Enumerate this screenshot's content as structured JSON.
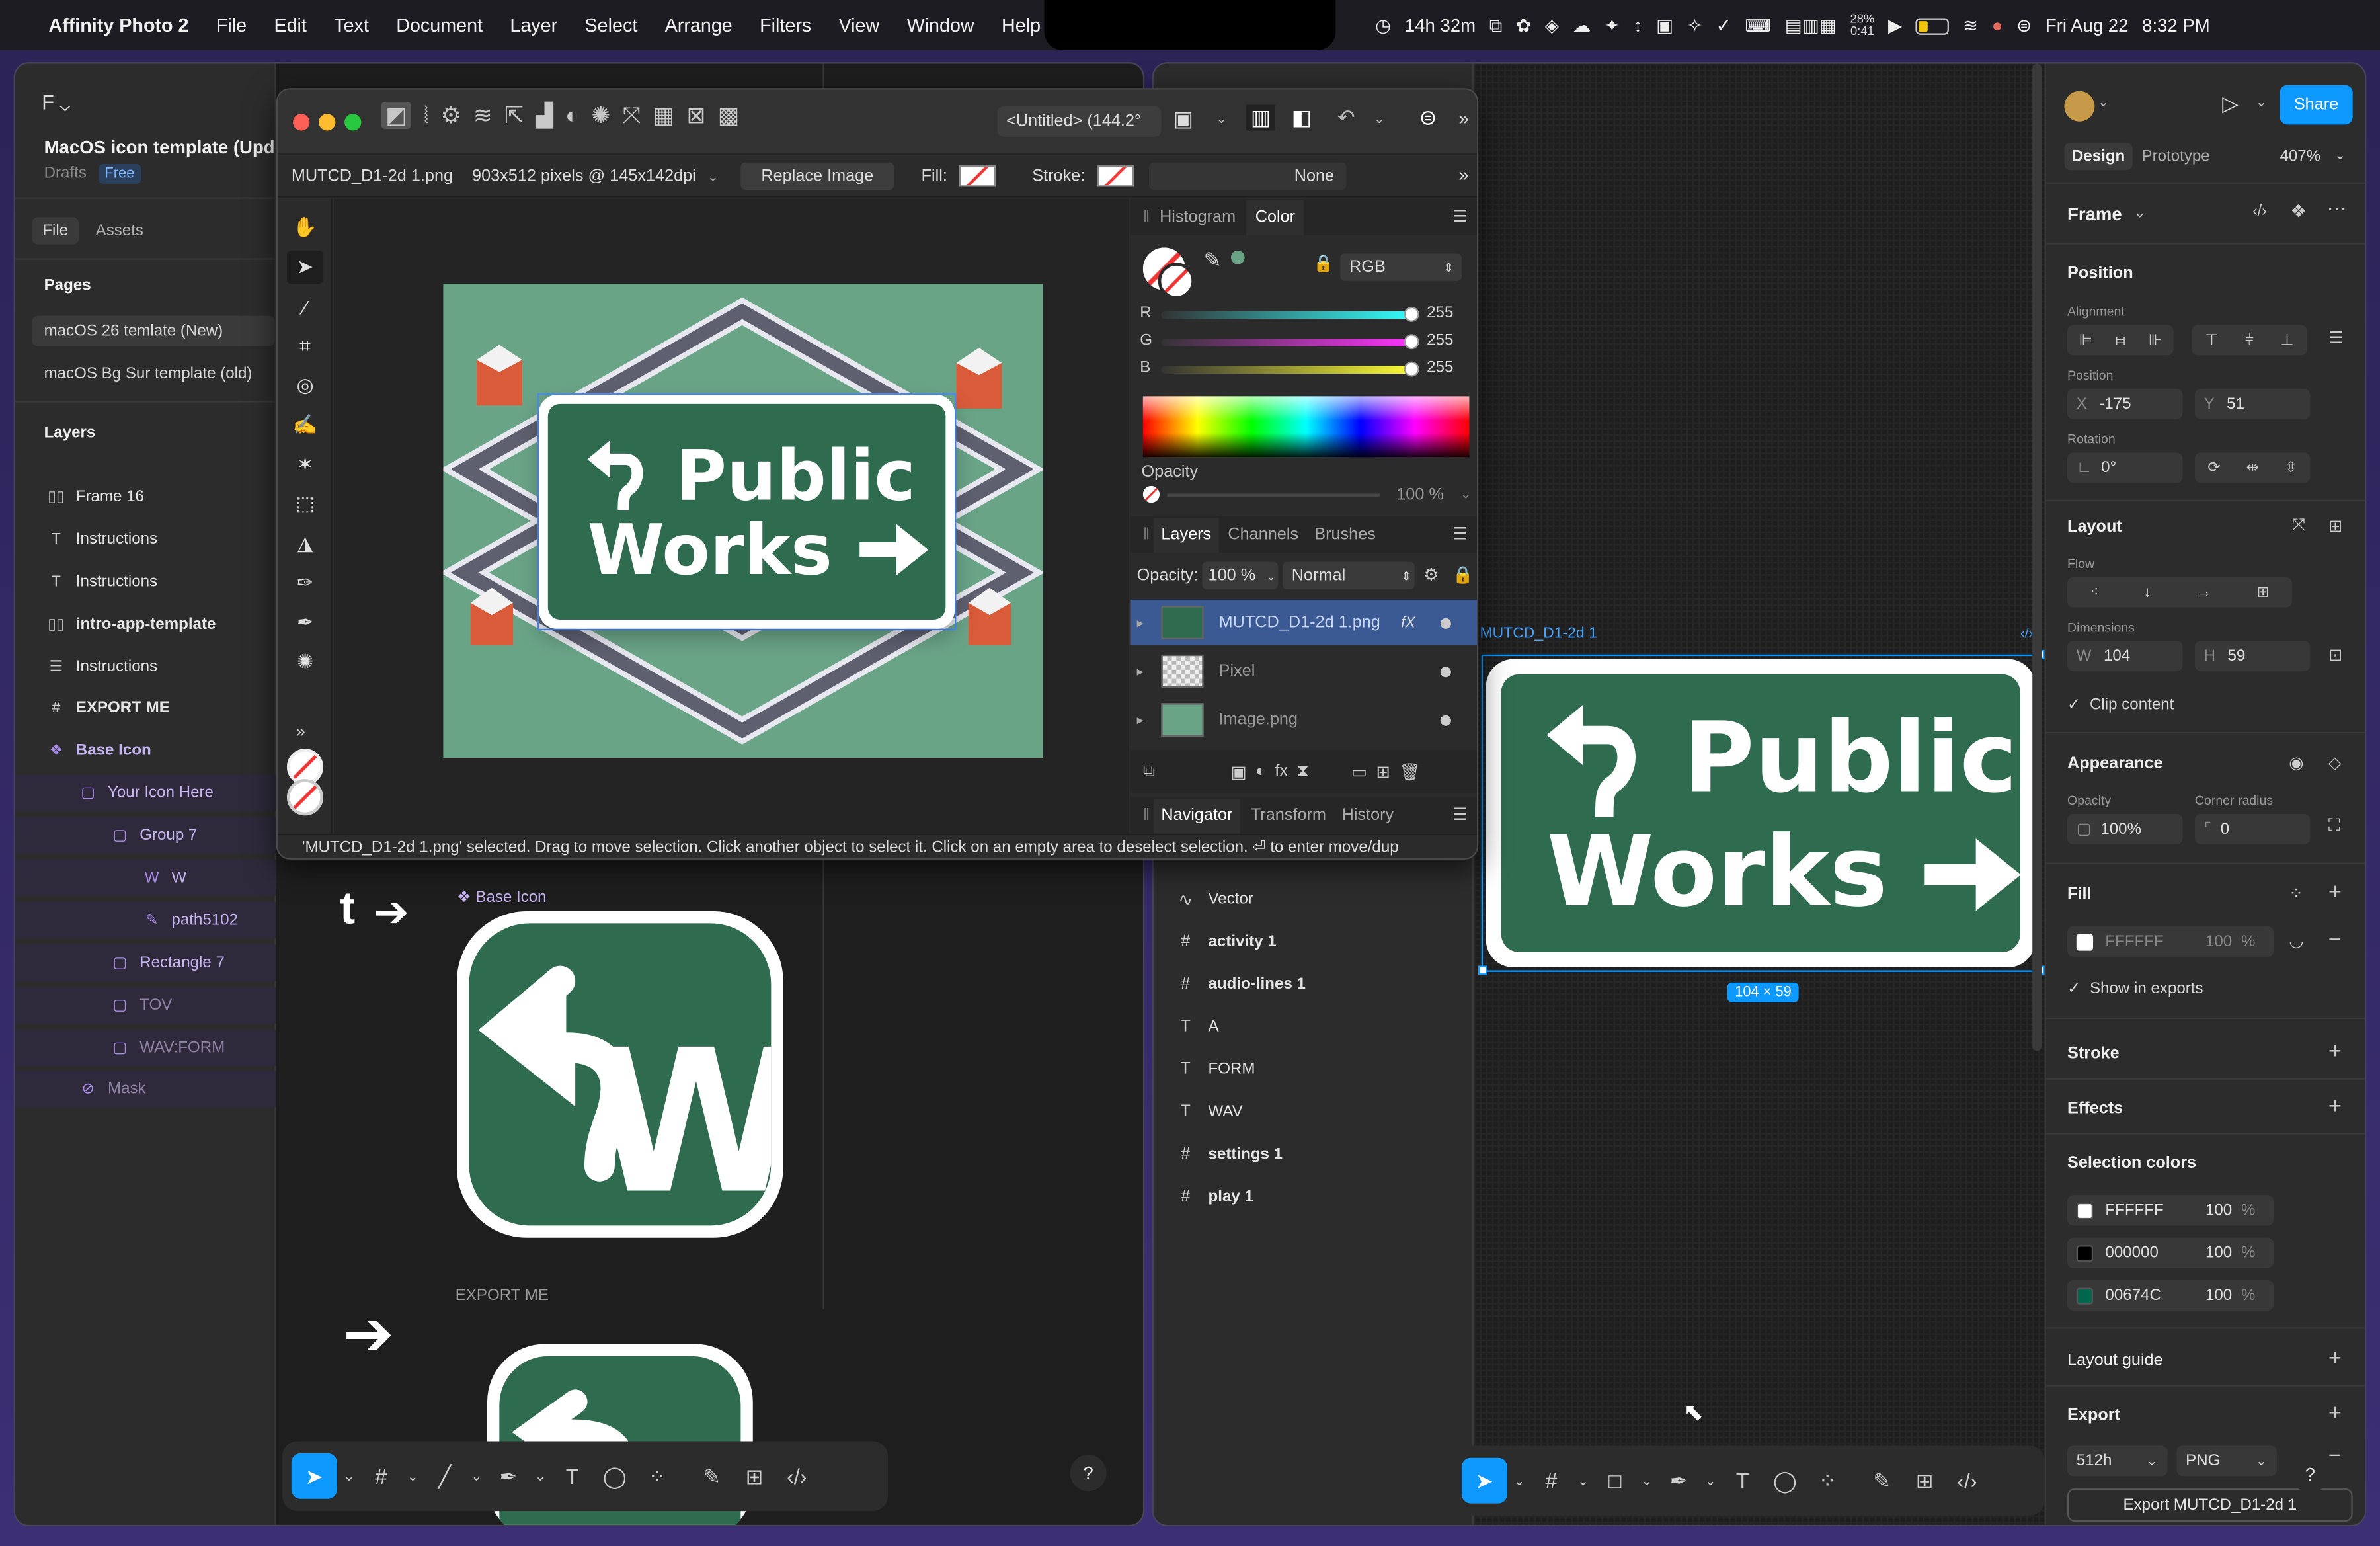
{
  "menubar": {
    "apple": "",
    "app": "Affinity Photo 2",
    "menus": [
      "File",
      "Edit",
      "Text",
      "Document",
      "Layer",
      "Select",
      "Arrange",
      "Filters",
      "View",
      "Window",
      "Help"
    ],
    "timer": "14h 32m",
    "battery_pct": "28%",
    "battery_time": "0:41",
    "date": "Fri Aug 22",
    "time": "8:32 PM"
  },
  "figma_left": {
    "file_title": "MacOS icon template (Upd...",
    "drafts": "Drafts",
    "plan_badge": "Free",
    "tabs": [
      "File",
      "Assets"
    ],
    "pages_label": "Pages",
    "pages": [
      "macOS 26 temlate (New)",
      "macOS Bg Sur template (old)"
    ],
    "layers_label": "Layers",
    "layers": [
      {
        "icon": "▯▯",
        "name": "Frame 16"
      },
      {
        "icon": "T",
        "name": "Instructions"
      },
      {
        "icon": "T",
        "name": "Instructions"
      },
      {
        "icon": "▯▯",
        "name": "intro-app-template"
      },
      {
        "icon": "☰",
        "name": "Instructions"
      },
      {
        "icon": "#",
        "name": "EXPORT ME"
      },
      {
        "icon": "❖",
        "name": "Base Icon"
      },
      {
        "icon": "▢",
        "name": "Your Icon Here"
      },
      {
        "icon": "▢",
        "name": "Group 7"
      },
      {
        "icon": "W",
        "name": "W"
      },
      {
        "icon": "✎",
        "name": "path5102"
      },
      {
        "icon": "▢",
        "name": "Rectangle 7"
      },
      {
        "icon": "▢",
        "name": "TOV"
      },
      {
        "icon": "▢",
        "name": "WAV:FORM"
      },
      {
        "icon": "⊘",
        "name": "Mask"
      }
    ],
    "canvas_label_base": "❖ Base Icon",
    "canvas_label_export": "EXPORT ME",
    "canvas_text_t": "t",
    "help": "?"
  },
  "affinity": {
    "doc_tab": "<Untitled> (144.2°",
    "context": {
      "layer": "MUTCD_D1-2d 1.png",
      "dims": "903x512 pixels @ 145x142dpi",
      "replace": "Replace Image",
      "fill": "Fill:",
      "stroke": "Stroke:",
      "none": "None"
    },
    "panel_tabs_top": [
      "Histogram",
      "Color"
    ],
    "color_mode": "RGB",
    "rgb": [
      {
        "ch": "R",
        "val": "255"
      },
      {
        "ch": "G",
        "val": "255"
      },
      {
        "ch": "B",
        "val": "255"
      }
    ],
    "opacity_label": "Opacity",
    "opacity_val": "100 %",
    "layer_tabs": [
      "Layers",
      "Channels",
      "Brushes"
    ],
    "layers_opacity_label": "Opacity:",
    "layers_opacity": "100 %",
    "blend": "Normal",
    "layers": [
      {
        "name": "MUTCD_D1-2d 1.png",
        "fx": "fX"
      },
      {
        "name": "Pixel",
        "fx": ""
      },
      {
        "name": "Image.png",
        "fx": ""
      }
    ],
    "nav_tabs": [
      "Navigator",
      "Transform",
      "History"
    ],
    "status": "'MUTCD_D1-2d 1.png' selected. Drag to move selection. Click another object to select it. Click on an empty area to deselect selection. ⏎ to enter move/dup"
  },
  "figma_right": {
    "layers": [
      {
        "icon": "∿",
        "name": "Vector",
        "bold": false
      },
      {
        "icon": "#",
        "name": "activity 1",
        "bold": true
      },
      {
        "icon": "#",
        "name": "audio-lines 1",
        "bold": true
      },
      {
        "icon": "T",
        "name": "A",
        "bold": false
      },
      {
        "icon": "T",
        "name": "FORM",
        "bold": false
      },
      {
        "icon": "T",
        "name": "WAV",
        "bold": false
      },
      {
        "icon": "#",
        "name": "settings 1",
        "bold": true
      },
      {
        "icon": "#",
        "name": "play 1",
        "bold": true
      }
    ],
    "frame_label": "MUTCD_D1-2d 1",
    "size_badge": "104 × 59",
    "help": "?"
  },
  "sign": {
    "line1": "Public",
    "line2": "Works",
    "small_letter": "W"
  },
  "design_panel": {
    "share": "Share",
    "tabs": [
      "Design",
      "Prototype"
    ],
    "zoom": "407%",
    "frame": "Frame",
    "position": "Position",
    "alignment": "Alignment",
    "position_sub": "Position",
    "x_label": "X",
    "x": "-175",
    "y_label": "Y",
    "y": "51",
    "rotation_label": "Rotation",
    "rotation": "0°",
    "layout": "Layout",
    "flow": "Flow",
    "dimensions": "Dimensions",
    "w_label": "W",
    "w": "104",
    "h_label": "H",
    "h": "59",
    "clip": "Clip content",
    "appearance": "Appearance",
    "opacity_label": "Opacity",
    "opacity": "100%",
    "radius_label": "Corner radius",
    "radius": "0",
    "fill": "Fill",
    "fill_hex": "FFFFFF",
    "fill_pct": "100",
    "pct": "%",
    "show_exports": "Show in exports",
    "stroke": "Stroke",
    "effects": "Effects",
    "selection_colors": "Selection colors",
    "colors": [
      {
        "hex": "FFFFFF",
        "pct": "100",
        "swatch": "#ffffff"
      },
      {
        "hex": "000000",
        "pct": "100",
        "swatch": "#000000"
      },
      {
        "hex": "00674C",
        "pct": "100",
        "swatch": "#00674c"
      }
    ],
    "layout_guide": "Layout guide",
    "export": "Export",
    "export_size": "512h",
    "export_format": "PNG",
    "export_button": "Export MUTCD_D1-2d 1"
  },
  "colors": {
    "accent": "#0d99ff",
    "sign_green": "#2e6b4f",
    "canvas_green": "#6aa487"
  }
}
